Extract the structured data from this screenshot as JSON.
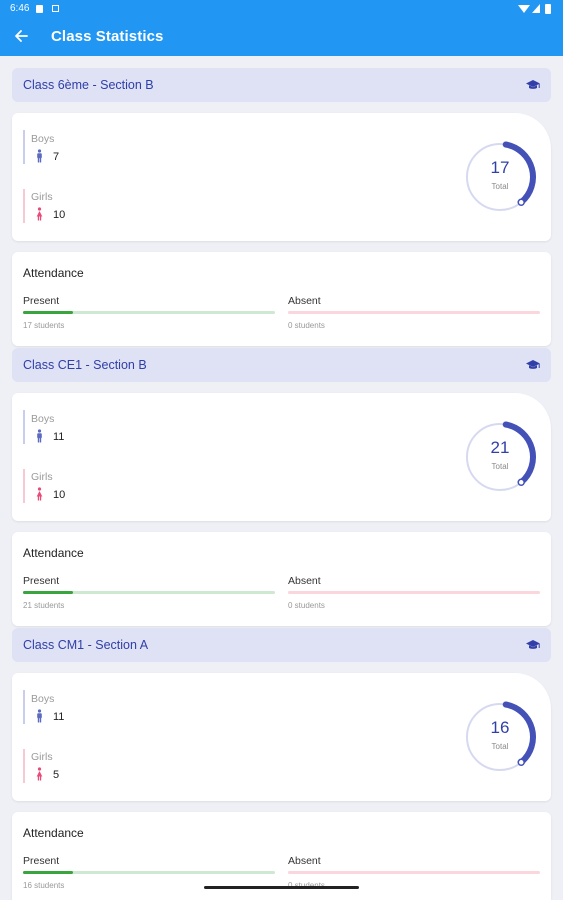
{
  "status_bar": {
    "time": "6:46"
  },
  "app_bar": {
    "back_icon": "arrow-left-icon",
    "title": "Class Statistics"
  },
  "total_label": "Total",
  "boys_label": "Boys",
  "girls_label": "Girls",
  "attendance_title": "Attendance",
  "present_label": "Present",
  "absent_label": "Absent",
  "classes": [
    {
      "name": "Class 6ème - Section B",
      "boys": "7",
      "girls": "10",
      "total": "17",
      "present_text": "17 students",
      "absent_text": "0 students",
      "present_fraction": 0.2,
      "absent_fraction": 0
    },
    {
      "name": "Class CE1 - Section B",
      "boys": "11",
      "girls": "10",
      "total": "21",
      "present_text": "21 students",
      "absent_text": "0 students",
      "present_fraction": 0.2,
      "absent_fraction": 0
    },
    {
      "name": "Class CM1 - Section A",
      "boys": "11",
      "girls": "5",
      "total": "16",
      "present_text": "16 students",
      "absent_text": "0 students",
      "present_fraction": 0.2,
      "absent_fraction": 0
    }
  ],
  "colors": {
    "app_bar": "#2196f3",
    "accent": "#3140a8",
    "boys": "#5c6bc0",
    "girls": "#e84a7a",
    "present": "#3aa43f",
    "absent": "#e85a75"
  }
}
